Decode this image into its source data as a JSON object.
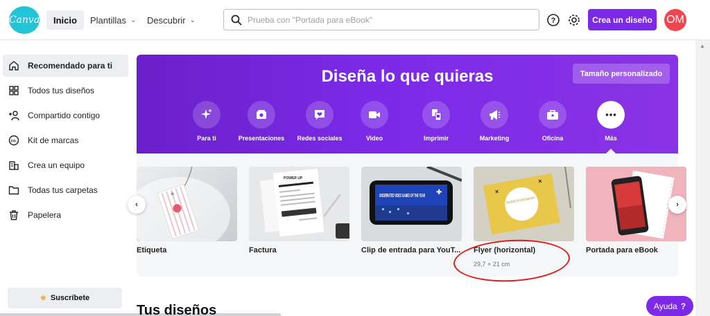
{
  "header": {
    "logo_text": "Canva",
    "nav": [
      {
        "label": "Inicio"
      },
      {
        "label": "Plantillas"
      },
      {
        "label": "Descubrir"
      }
    ],
    "search_placeholder": "Prueba con \"Portada para eBook\"",
    "create_label": "Crea un diseño",
    "avatar_initials": "OM",
    "brand_color": "#7d2ae8"
  },
  "sidebar": {
    "items": [
      {
        "label": "Recomendado para ti",
        "icon": "home-icon"
      },
      {
        "label": "Todos tus diseños",
        "icon": "grid-icon"
      },
      {
        "label": "Compartido contigo",
        "icon": "people-icon"
      },
      {
        "label": "Kit de marcas",
        "icon": "brand-kit-icon"
      },
      {
        "label": "Crea un equipo",
        "icon": "team-icon"
      },
      {
        "label": "Todas tus carpetas",
        "icon": "folder-icon"
      },
      {
        "label": "Papelera",
        "icon": "trash-icon"
      }
    ],
    "subscribe_label": "Suscríbete"
  },
  "hero": {
    "title": "Diseña lo que quieras",
    "custom_size_label": "Tamaño personalizado",
    "categories": [
      {
        "label": "Para ti",
        "icon": "sparkle-icon"
      },
      {
        "label": "Presentaciones",
        "icon": "presentation-icon"
      },
      {
        "label": "Redes sociales",
        "icon": "heart-chat-icon"
      },
      {
        "label": "Video",
        "icon": "video-camera-icon"
      },
      {
        "label": "Imprimir",
        "icon": "print-icon"
      },
      {
        "label": "Marketing",
        "icon": "megaphone-icon"
      },
      {
        "label": "Oficina",
        "icon": "briefcase-icon"
      },
      {
        "label": "Más",
        "icon": "more-icon"
      }
    ]
  },
  "templates": [
    {
      "label": "Etiqueta",
      "sub": ""
    },
    {
      "label": "Factura",
      "sub": ""
    },
    {
      "label": "Clip de entrada para YouT...",
      "sub": ""
    },
    {
      "label": "Flyer (horizontal)",
      "sub": "29,7 × 21 cm"
    },
    {
      "label": "Portada para eBook",
      "sub": ""
    }
  ],
  "thumb_text": {
    "invoice": "POWER UP",
    "clip": "UNDERRATED VIDEO GAMES OF THE YEAR",
    "flyer": "NEW YEAR'S EVE COUNTDOWN PARTY",
    "ebook": "THE SILENT RIVER"
  },
  "section_title": "Tus diseños",
  "help": {
    "label": "Ayuda",
    "mark": "?"
  }
}
